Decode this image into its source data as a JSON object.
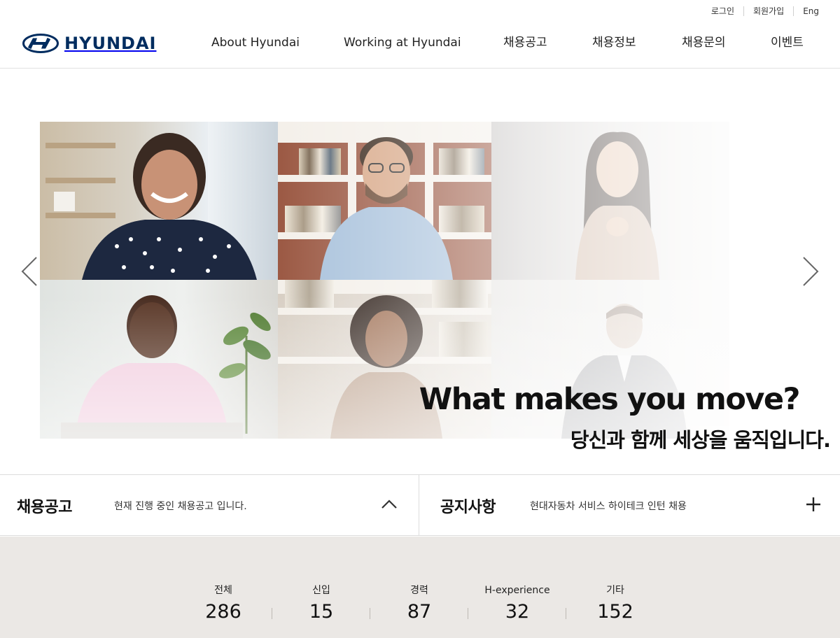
{
  "util_nav": {
    "login": "로그인",
    "signup": "회원가입",
    "lang": "Eng"
  },
  "brand": {
    "name": "HYUNDAI",
    "color": "#002c5f"
  },
  "gnb": [
    {
      "label": "About Hyundai"
    },
    {
      "label": "Working at Hyundai"
    },
    {
      "label": "채용공고"
    },
    {
      "label": "채용정보"
    },
    {
      "label": "채용문의"
    },
    {
      "label": "이벤트"
    }
  ],
  "hero": {
    "title": "What makes you move?",
    "subtitle": "당신과 함께 세상을 움직입니다.",
    "prev_icon": "chevron-left-icon",
    "next_icon": "chevron-right-icon"
  },
  "jobs_bar": {
    "title": "채용공고",
    "text": "현재 진행 중인 채용공고 입니다.",
    "icon": "chevron-up-icon"
  },
  "notice_bar": {
    "title": "공지사항",
    "text": "현대자동차 서비스 하이테크 인턴 채용",
    "icon": "plus-icon"
  },
  "stats": [
    {
      "label": "전체",
      "value": "286"
    },
    {
      "label": "신입",
      "value": "15"
    },
    {
      "label": "경력",
      "value": "87"
    },
    {
      "label": "H-experience",
      "value": "32"
    },
    {
      "label": "기타",
      "value": "152"
    }
  ],
  "colors": {
    "stats_bg": "#ebe8e5",
    "text": "#111111"
  }
}
